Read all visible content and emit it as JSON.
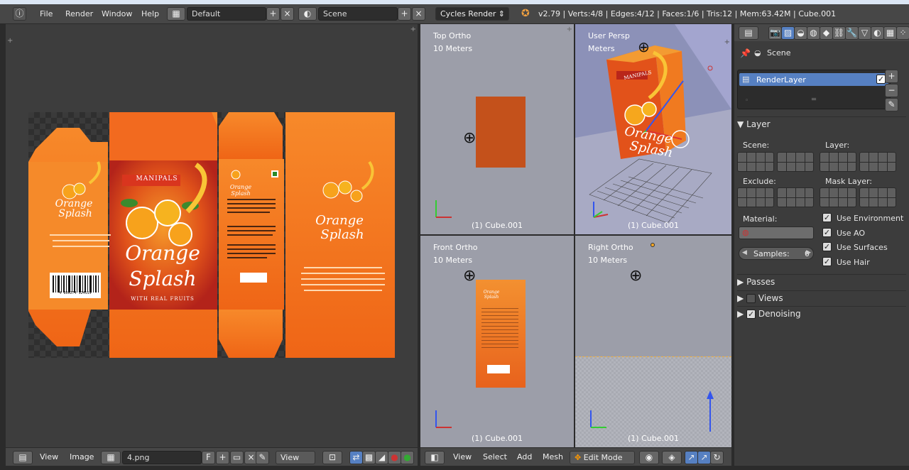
{
  "topbar": {
    "menus": [
      "File",
      "Render",
      "Window",
      "Help"
    ],
    "layout": "Default",
    "scene": "Scene",
    "engine": "Cycles Render",
    "status": "v2.79 | Verts:4/8 | Edges:4/12 | Faces:1/6 | Tris:12 | Mem:63.42M | Cube.001"
  },
  "image_editor": {
    "header": {
      "view": "View",
      "image": "Image",
      "filename": "4.png",
      "fake_user": "F",
      "view_dropdown": "View"
    },
    "package": {
      "brand": "MANIPALS",
      "title_line1": "Orange",
      "title_line2": "Splash",
      "tagline": "WITH REAL FRUITS",
      "side_title1": "Orange",
      "side_title2": "Splash",
      "barcode_number": "4 800274 124119"
    }
  },
  "viewports": {
    "top_left": {
      "name": "Top Ortho",
      "scale": "10 Meters",
      "object": "(1) Cube.001"
    },
    "top_right": {
      "name": "User Persp",
      "scale": "Meters",
      "object": "(1) Cube.001"
    },
    "bottom_left": {
      "name": "Front Ortho",
      "scale": "10 Meters",
      "object": "(1) Cube.001"
    },
    "bottom_right": {
      "name": "Right Ortho",
      "scale": "10 Meters",
      "object": "(1) Cube.001"
    },
    "header": {
      "view": "View",
      "select": "Select",
      "add": "Add",
      "mesh": "Mesh",
      "mode": "Edit Mode"
    }
  },
  "properties": {
    "scene_label": "Scene",
    "render_layer": "RenderLayer",
    "layer_panel": "Layer",
    "scene_field": "Scene:",
    "layer_field": "Layer:",
    "exclude_field": "Exclude:",
    "mask_layer_field": "Mask Layer:",
    "material_label": "Material:",
    "samples_label": "Samples:",
    "samples_value": "0",
    "checkboxes": [
      "Use Environment",
      "Use AO",
      "Use Surfaces",
      "Use Hair"
    ],
    "passes": "Passes",
    "views": "Views",
    "denoising": "Denoising"
  },
  "colors": {
    "orange": "#f26a1f",
    "dark_orange": "#c9490f",
    "header": "#474747",
    "viewport": "#9c9ea9",
    "selected": "#5680c2"
  }
}
